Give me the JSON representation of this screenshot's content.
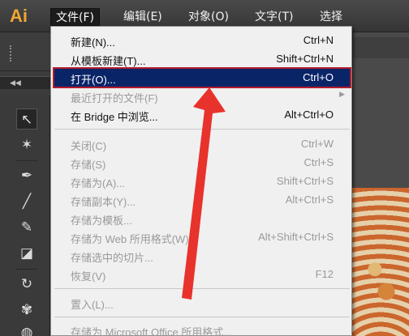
{
  "app": {
    "logo_text": "Ai",
    "accent": "#f0a732"
  },
  "menubar": {
    "items": [
      {
        "label": "文件(F)",
        "active": true
      },
      {
        "label": "编辑(E)"
      },
      {
        "label": "对象(O)"
      },
      {
        "label": "文字(T)"
      },
      {
        "label": "选择"
      }
    ]
  },
  "file_menu": {
    "items": [
      {
        "label": "新建(N)...",
        "shortcut": "Ctrl+N",
        "enabled": true
      },
      {
        "label": "从模板新建(T)...",
        "shortcut": "Shift+Ctrl+N",
        "enabled": true
      },
      {
        "label": "打开(O)...",
        "shortcut": "Ctrl+O",
        "enabled": true,
        "highlighted": true
      },
      {
        "label": "最近打开的文件(F)",
        "shortcut": "",
        "enabled": false,
        "submenu": true
      },
      {
        "label": "在 Bridge 中浏览...",
        "shortcut": "Alt+Ctrl+O",
        "enabled": true
      },
      {
        "label": "关闭(C)",
        "shortcut": "Ctrl+W",
        "enabled": false
      },
      {
        "label": "存储(S)",
        "shortcut": "Ctrl+S",
        "enabled": false
      },
      {
        "label": "存储为(A)...",
        "shortcut": "Shift+Ctrl+S",
        "enabled": false
      },
      {
        "label": "存储副本(Y)...",
        "shortcut": "Alt+Ctrl+S",
        "enabled": false
      },
      {
        "label": "存储为模板...",
        "shortcut": "",
        "enabled": false
      },
      {
        "label": "存储为 Web 所用格式(W)...",
        "shortcut": "Alt+Shift+Ctrl+S",
        "enabled": false
      },
      {
        "label": "存储选中的切片...",
        "shortcut": "",
        "enabled": false
      },
      {
        "label": "恢复(V)",
        "shortcut": "F12",
        "enabled": false
      },
      {
        "label": "置入(L)...",
        "shortcut": "",
        "enabled": false
      },
      {
        "label": "存储为 Microsoft Office 所用格式...",
        "shortcut": "",
        "enabled": false
      }
    ]
  },
  "tools": [
    {
      "icon": "selection-arrow-icon",
      "glyph": "↖",
      "selected": true
    },
    {
      "icon": "magic-wand-icon",
      "glyph": "✶"
    },
    {
      "icon": "pen-tool-icon",
      "glyph": "✒"
    },
    {
      "icon": "line-tool-icon",
      "glyph": "╱"
    },
    {
      "icon": "paintbrush-icon",
      "glyph": "✎"
    },
    {
      "icon": "eraser-icon",
      "glyph": "◪"
    },
    {
      "icon": "rotate-tool-icon",
      "glyph": "↻"
    },
    {
      "icon": "warp-tool-icon",
      "glyph": "✾"
    },
    {
      "icon": "symbol-sprayer-icon",
      "glyph": "◍"
    }
  ],
  "colors": {
    "highlight_bg": "#0a2468",
    "highlight_outline": "#b31b2c",
    "arrow": "#e8322c"
  }
}
